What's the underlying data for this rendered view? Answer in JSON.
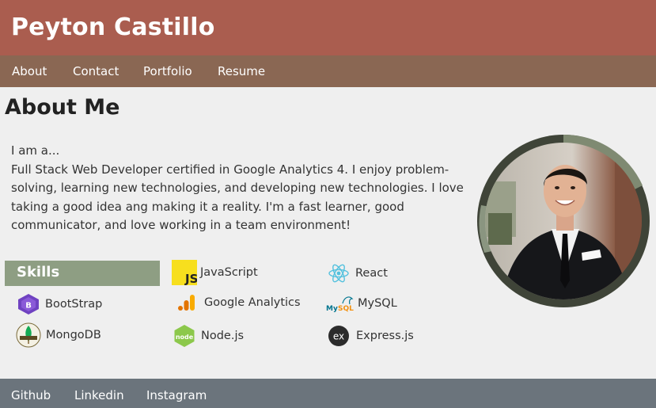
{
  "header": {
    "name": "Peyton Castillo"
  },
  "nav": {
    "items": [
      "About",
      "Contact",
      "Portfolio",
      "Resume"
    ]
  },
  "about": {
    "title": "About Me",
    "lead": "I am a...",
    "body": "Full Stack Web Developer certified in Google Analytics 4. I enjoy problem-solving, learning new technologies, and developing new technologies. I love taking a good idea ang making it a reality. I'm a fast learner, good communicator, and love working in a team environment!"
  },
  "skills": {
    "label": "Skills",
    "items": [
      {
        "name": "JavaScript",
        "icon": "javascript-icon"
      },
      {
        "name": "React",
        "icon": "react-icon"
      },
      {
        "name": "BootStrap",
        "icon": "bootstrap-icon"
      },
      {
        "name": "Google Analytics",
        "icon": "google-analytics-icon"
      },
      {
        "name": "MySQL",
        "icon": "mysql-icon"
      },
      {
        "name": "MongoDB",
        "icon": "mongodb-icon"
      },
      {
        "name": "Node.js",
        "icon": "nodejs-icon"
      },
      {
        "name": "Express.js",
        "icon": "expressjs-icon"
      }
    ]
  },
  "footer": {
    "links": [
      "Github",
      "Linkedin",
      "Instagram"
    ]
  },
  "colors": {
    "header": "#aa5d4f",
    "nav": "#8a6753",
    "skills_label": "#8e9e83",
    "footer": "#6b747c",
    "portrait_ring": "#6f7a66"
  }
}
